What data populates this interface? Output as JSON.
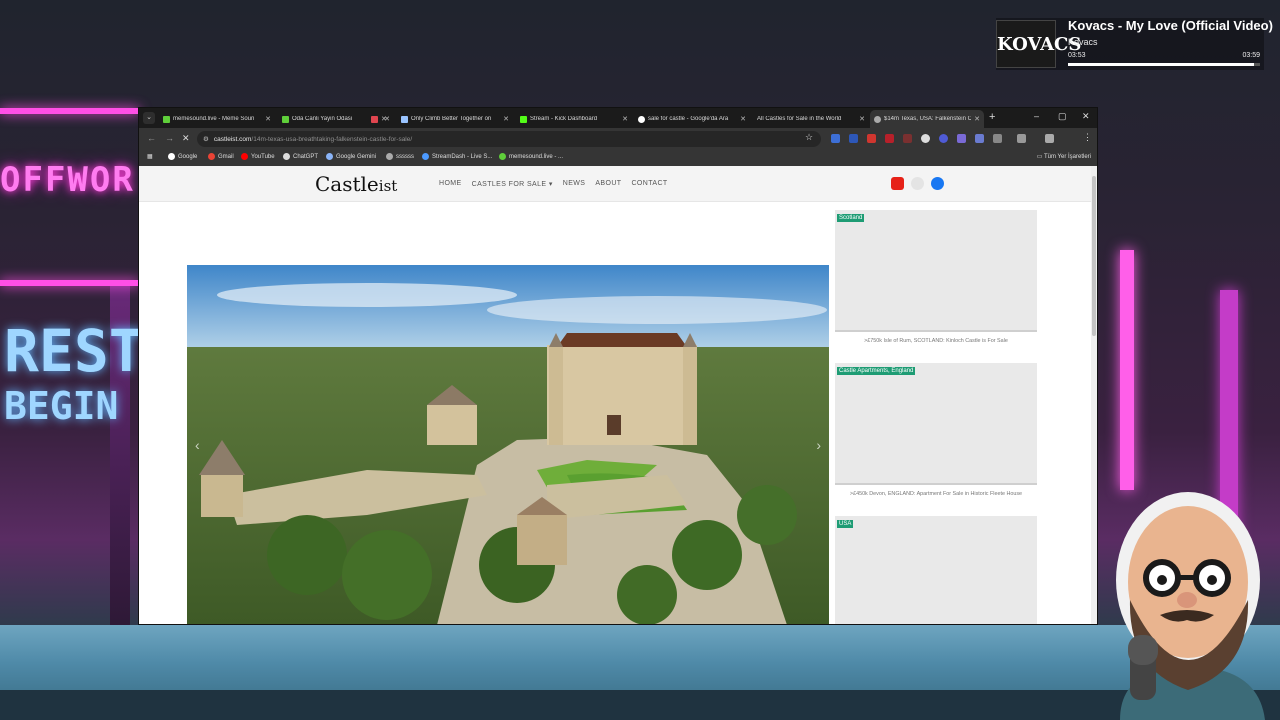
{
  "now_playing": {
    "title": "Kovacs - My Love (Official Video)",
    "artist": "Kovacs",
    "elapsed": "03:53",
    "total": "03:59",
    "art_text": "KOVACS",
    "progress_pct": 97
  },
  "scene": {
    "neon_left_word": "OFFWOR",
    "neon_rest": "REST",
    "neon_begin": "BEGIN"
  },
  "browser": {
    "tabs": [
      {
        "label": "memesound.live - Meme Soun",
        "fav_color": "#5fcf3a"
      },
      {
        "label": "Oda Canli Yayin Odasi",
        "fav_color": "#5fcf3a"
      },
      {
        "label": "",
        "fav_color": "#e0454f"
      },
      {
        "label": "Only Climb Better Together on",
        "fav_color": "#9ac4ff"
      },
      {
        "label": "Stream - Kick Dashboard",
        "fav_color": "#53fc18"
      },
      {
        "label": "sale for castle - Google'da Ara",
        "fav_color": "#ffffff"
      },
      {
        "label": "All Castles for Sale in the World",
        "fav_color": "#cccccc"
      },
      {
        "label": "$14m Texas, USA: Falkenstein C",
        "fav_color": "#aaaaaa"
      }
    ],
    "url_domain": "castleist.com",
    "url_path": "/14m-texas-usa-breathtaking-falkenstein-castle-for-sale/",
    "bookmarks": [
      {
        "label": "Google",
        "color": "#ffffff"
      },
      {
        "label": "Gmail",
        "color": "#ea4335"
      },
      {
        "label": "YouTube",
        "color": "#ff0000"
      },
      {
        "label": "ChatGPT",
        "color": "#dddddd"
      },
      {
        "label": "Google Gemini",
        "color": "#8ab4f8"
      },
      {
        "label": "ssssss",
        "color": "#aaaaaa"
      },
      {
        "label": "StreamDash - Live S...",
        "color": "#4c9aff"
      },
      {
        "label": "memesound.live - ...",
        "color": "#5fcf3a"
      }
    ],
    "bookmarks_folder": "Tüm Yer İşaretleri"
  },
  "site": {
    "logo_main": "Castle",
    "logo_suffix": "ist",
    "nav": [
      "HOME",
      "CASTLES FOR SALE ▾",
      "NEWS",
      "ABOUT",
      "CONTACT"
    ],
    "sidebar": [
      {
        "tag": "Scotland",
        "caption": ">£750k Isle of Rum, SCOTLAND: Kinloch Castle is For Sale"
      },
      {
        "tag": "Castle Apartments, England",
        "caption": ">£450k Devon, ENGLAND: Apartment For Sale in Historic Fleete House"
      },
      {
        "tag": "USA",
        "caption": ""
      }
    ]
  }
}
